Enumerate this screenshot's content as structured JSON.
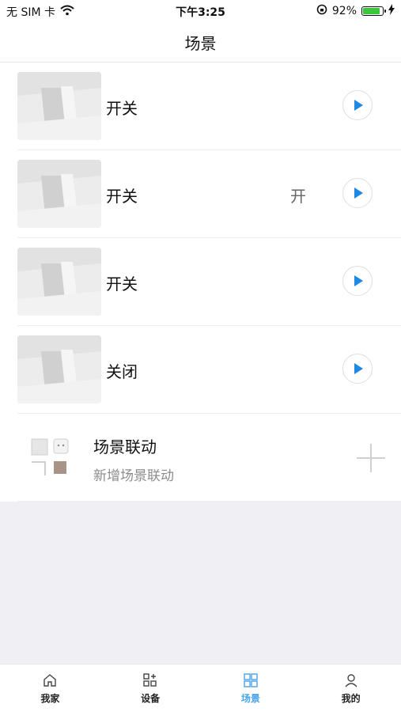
{
  "status": {
    "carrier": "无 SIM 卡",
    "time": "下午3:25",
    "battery": "92%",
    "battery_fraction": 0.92
  },
  "header": {
    "title": "场景"
  },
  "scenes": [
    {
      "title": "开关",
      "state": ""
    },
    {
      "title": "开关",
      "state": "开"
    },
    {
      "title": "开关",
      "state": ""
    },
    {
      "title": "关闭",
      "state": ""
    }
  ],
  "linkage": {
    "title": "场景联动",
    "subtitle": "新增场景联动"
  },
  "tabs": [
    {
      "label": "我家",
      "icon": "home-icon"
    },
    {
      "label": "设备",
      "icon": "devices-icon"
    },
    {
      "label": "场景",
      "icon": "scenes-icon"
    },
    {
      "label": "我的",
      "icon": "user-icon"
    }
  ],
  "colors": {
    "accent": "#4aa3ec",
    "play": "#1e88e5",
    "battery": "#3cc63c"
  }
}
